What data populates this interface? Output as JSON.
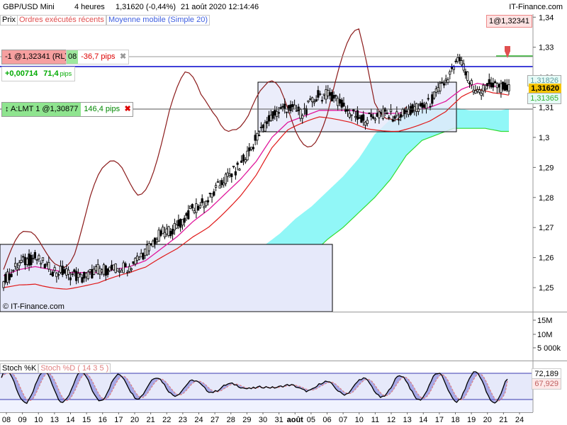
{
  "header": {
    "instrument": "GBP/USD Mini",
    "timeframe": "4 heures",
    "price_change": "1,31620 (-0,44%)",
    "datetime": "21 août 2020 12:14:46",
    "brand": "IT-Finance.com"
  },
  "legend": {
    "prix": "Prix",
    "ordres": "Ordres exécutés récents",
    "moyenne": "Moyenne mobile (Simple 20)"
  },
  "position_tag": "1@1,32341",
  "order_tags": {
    "sell_label": "-1 @1,32341",
    "sell_suffix": "(RL)",
    "sell_pips": "-36,7 pips",
    "sell_hidden_tail": "08",
    "gain_value": "+0,00714",
    "gain_pips": "71,4",
    "gain_pips_unit": "pips",
    "limit_label": "A:LMT  1 @1,30877",
    "limit_pips": "146,4 pips",
    "close_x": "✖"
  },
  "watermark": "© IT-Finance.com",
  "price_axis": {
    "ticks": [
      "1,34",
      "1,33",
      "1,32",
      "1,31",
      "1,3",
      "1,29",
      "1,28",
      "1,27",
      "1,26",
      "1,25"
    ],
    "boxes": {
      "upper": "1,31826",
      "last": "1,31620",
      "lower": "1,31365"
    }
  },
  "volume_axis": {
    "ticks": [
      "15M",
      "10M",
      "5 000k"
    ]
  },
  "stoch": {
    "k_label": "Stoch %K",
    "d_label": "Stoch %D ( 14 3 5 )",
    "k_value": "72,189",
    "d_value": "67,929"
  },
  "x_axis": {
    "labels": [
      "08",
      "09",
      "10",
      "13",
      "14",
      "15",
      "16",
      "17",
      "20",
      "21",
      "22",
      "23",
      "24",
      "27",
      "28",
      "29",
      "30",
      "31",
      "août",
      "05",
      "06",
      "07",
      "10",
      "11",
      "12",
      "13",
      "14",
      "17",
      "18",
      "19",
      "20",
      "21",
      "24"
    ]
  },
  "colors": {
    "candle": "#000000",
    "ma_pink": "#e0189c",
    "kijun_red": "#e01818",
    "chikou": "#8b1a1a",
    "cloud_cyan": "#7ef6f6",
    "cloud_green": "#32dc32",
    "sell_line": "#0000cc",
    "stoch_k": "#000000",
    "stoch_d": "#e08080"
  },
  "chart_data": {
    "type": "candlestick",
    "title": "GBP/USD Mini 4 heures",
    "ylim": [
      1.242,
      1.341
    ],
    "x": [
      "08",
      "09",
      "10",
      "13",
      "14",
      "15",
      "16",
      "17",
      "20",
      "21",
      "22",
      "23",
      "24",
      "27",
      "28",
      "29",
      "30",
      "31",
      "août",
      "05",
      "06",
      "07",
      "10",
      "11",
      "12",
      "13",
      "14",
      "17",
      "18",
      "19",
      "20",
      "21",
      "24"
    ],
    "close_series": [
      1.252,
      1.258,
      1.26,
      1.256,
      1.255,
      1.253,
      1.256,
      1.256,
      1.257,
      1.262,
      1.268,
      1.27,
      1.276,
      1.279,
      1.286,
      1.29,
      1.299,
      1.307,
      1.31,
      1.308,
      1.314,
      1.314,
      1.308,
      1.306,
      1.308,
      1.307,
      1.309,
      1.311,
      1.318,
      1.326,
      1.314,
      1.318,
      1.316
    ],
    "moving_average_simple_20": [
      1.254,
      1.256,
      1.257,
      1.256,
      1.255,
      1.255,
      1.255,
      1.256,
      1.257,
      1.259,
      1.263,
      1.267,
      1.272,
      1.276,
      1.281,
      1.286,
      1.292,
      1.3,
      1.305,
      1.307,
      1.309,
      1.309,
      1.309,
      1.308,
      1.308,
      1.308,
      1.309,
      1.31,
      1.312,
      1.316,
      1.318,
      1.317,
      1.317
    ],
    "markers": {
      "last_price": 1.3162,
      "sell_order": 1.32341,
      "limit_order": 1.30877,
      "upper_band": 1.31826,
      "lower_band": 1.31365
    },
    "stochastic": {
      "k_last": 72.189,
      "d_last": 67.929,
      "params": "14 3 5"
    }
  }
}
